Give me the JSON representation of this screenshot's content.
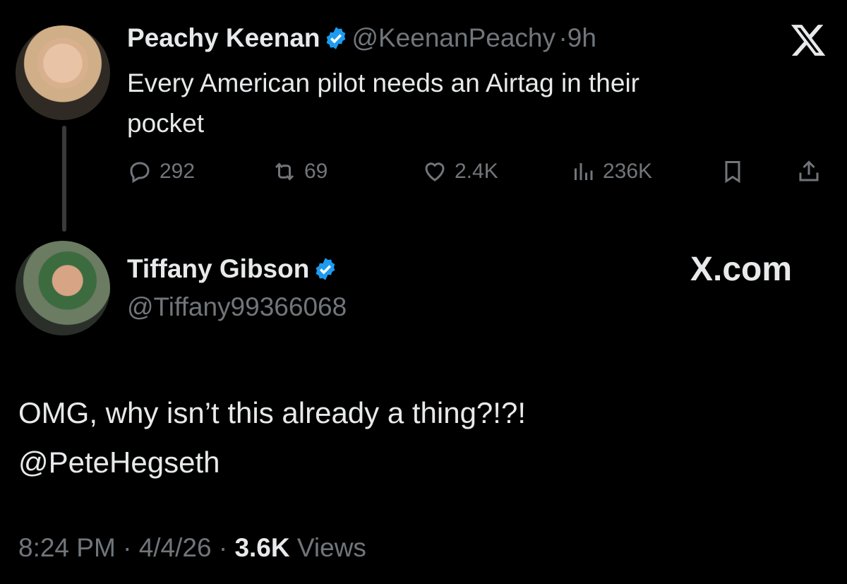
{
  "parent_tweet": {
    "display_name": "Peachy Keenan",
    "handle": "@KeenanPeachy",
    "time_ago": "9h",
    "text_line1": "Every American pilot needs an Airtag in their",
    "text_line2": "pocket",
    "metrics": {
      "replies": "292",
      "reposts": "69",
      "likes": "2.4K",
      "views": "236K"
    }
  },
  "reply_tweet": {
    "display_name": "Tiffany Gibson",
    "handle": "@Tiffany99366068",
    "text_line1": "OMG, why isn’t this already a thing?!?!",
    "text_line2": "@PeteHegseth",
    "time": "8:24 PM",
    "date": "4/4/26",
    "views_count": "3.6K",
    "views_label": "Views"
  },
  "brand": {
    "watermark": "X.com",
    "accent_color": "#1d9bf0"
  },
  "icons": [
    "x-logo-icon",
    "verified-badge-icon",
    "reply-icon",
    "repost-icon",
    "like-icon",
    "views-icon",
    "bookmark-icon",
    "share-icon"
  ]
}
